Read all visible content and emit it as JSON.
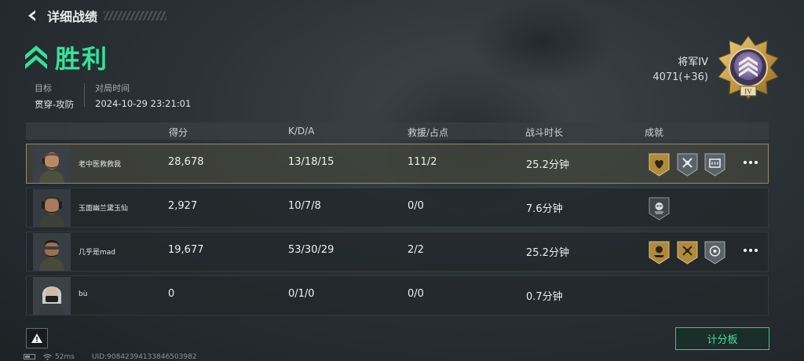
{
  "header": {
    "title": "详细战绩"
  },
  "result": {
    "label": "胜利",
    "color": "#33e39a"
  },
  "match": {
    "objective_label": "目标",
    "objective_value": "贯穿-攻防",
    "time_label": "对局时间",
    "time_value": "2024-10-29 23:21:01"
  },
  "rank": {
    "name": "将军IV",
    "points": "4071(+36)",
    "badge_numeral": "IV"
  },
  "table": {
    "headers": [
      "得分",
      "K/D/A",
      "救援/占点",
      "战斗时长",
      "成就"
    ],
    "rows": [
      {
        "name": "老中医救救我",
        "score": "28,678",
        "kda": "13/18/15",
        "rescue": "111/2",
        "duration": "25.2分钟",
        "achievements": [
          "gold-heart-badge",
          "silver-axes-badge",
          "silver-box-badge"
        ],
        "more": true,
        "highlight": true
      },
      {
        "name": "玉面幽兰黛玉仙",
        "score": "2,927",
        "kda": "10/7/8",
        "rescue": "0/0",
        "duration": "7.6分钟",
        "achievements": [
          "silver-skull-badge"
        ],
        "more": false,
        "highlight": false
      },
      {
        "name": "几乎是mad",
        "score": "19,677",
        "kda": "53/30/29",
        "rescue": "2/2",
        "duration": "25.2分钟",
        "achievements": [
          "gold-rose-badge",
          "gold-axes-badge",
          "silver-target-badge"
        ],
        "more": true,
        "highlight": false
      },
      {
        "name": "bù",
        "score": "0",
        "kda": "0/1/0",
        "rescue": "0/0",
        "duration": "0.7分钟",
        "achievements": [],
        "more": false,
        "highlight": false
      }
    ]
  },
  "buttons": {
    "scoreboard": "计分板"
  },
  "status": {
    "ping": "52ms",
    "uid": "UID:908423941338465039​82"
  },
  "colors": {
    "accent": "#33e39a",
    "gold": "#c9a14a",
    "silver": "#9aa3a7"
  }
}
